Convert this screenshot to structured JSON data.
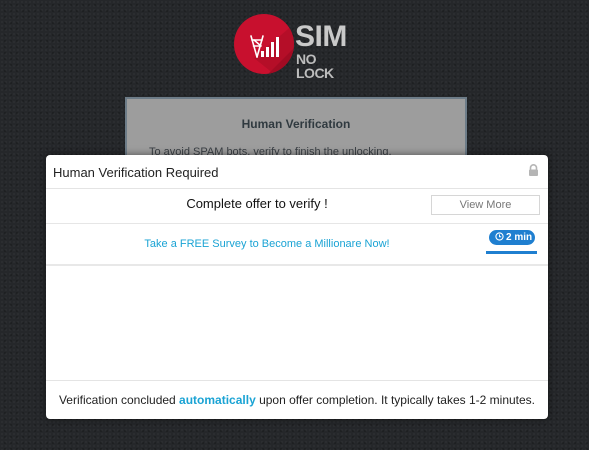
{
  "brand": {
    "name_line1": "SIM",
    "name_line2": "NO LOCK",
    "icon": "signal-tower-icon",
    "color": "#c8102e"
  },
  "background_card": {
    "title": "Human Verification",
    "text": "To avoid SPAM bots, verify to finish the unlocking."
  },
  "modal": {
    "title": "Human Verification Required",
    "lock_icon": "lock-icon",
    "offer_heading": "Complete offer to verify !",
    "view_more_label": "View More",
    "offer": {
      "title": "Take a FREE Survey to Become a Millionare Now!",
      "time": "2 min",
      "time_icon": "clock-icon"
    },
    "footer": {
      "before": "Verification concluded ",
      "highlight": "automatically",
      "after": " upon offer completion. It typically takes 1-2 minutes."
    },
    "accent_color": "#1aa3d4",
    "badge_color": "#1f7fd0"
  }
}
